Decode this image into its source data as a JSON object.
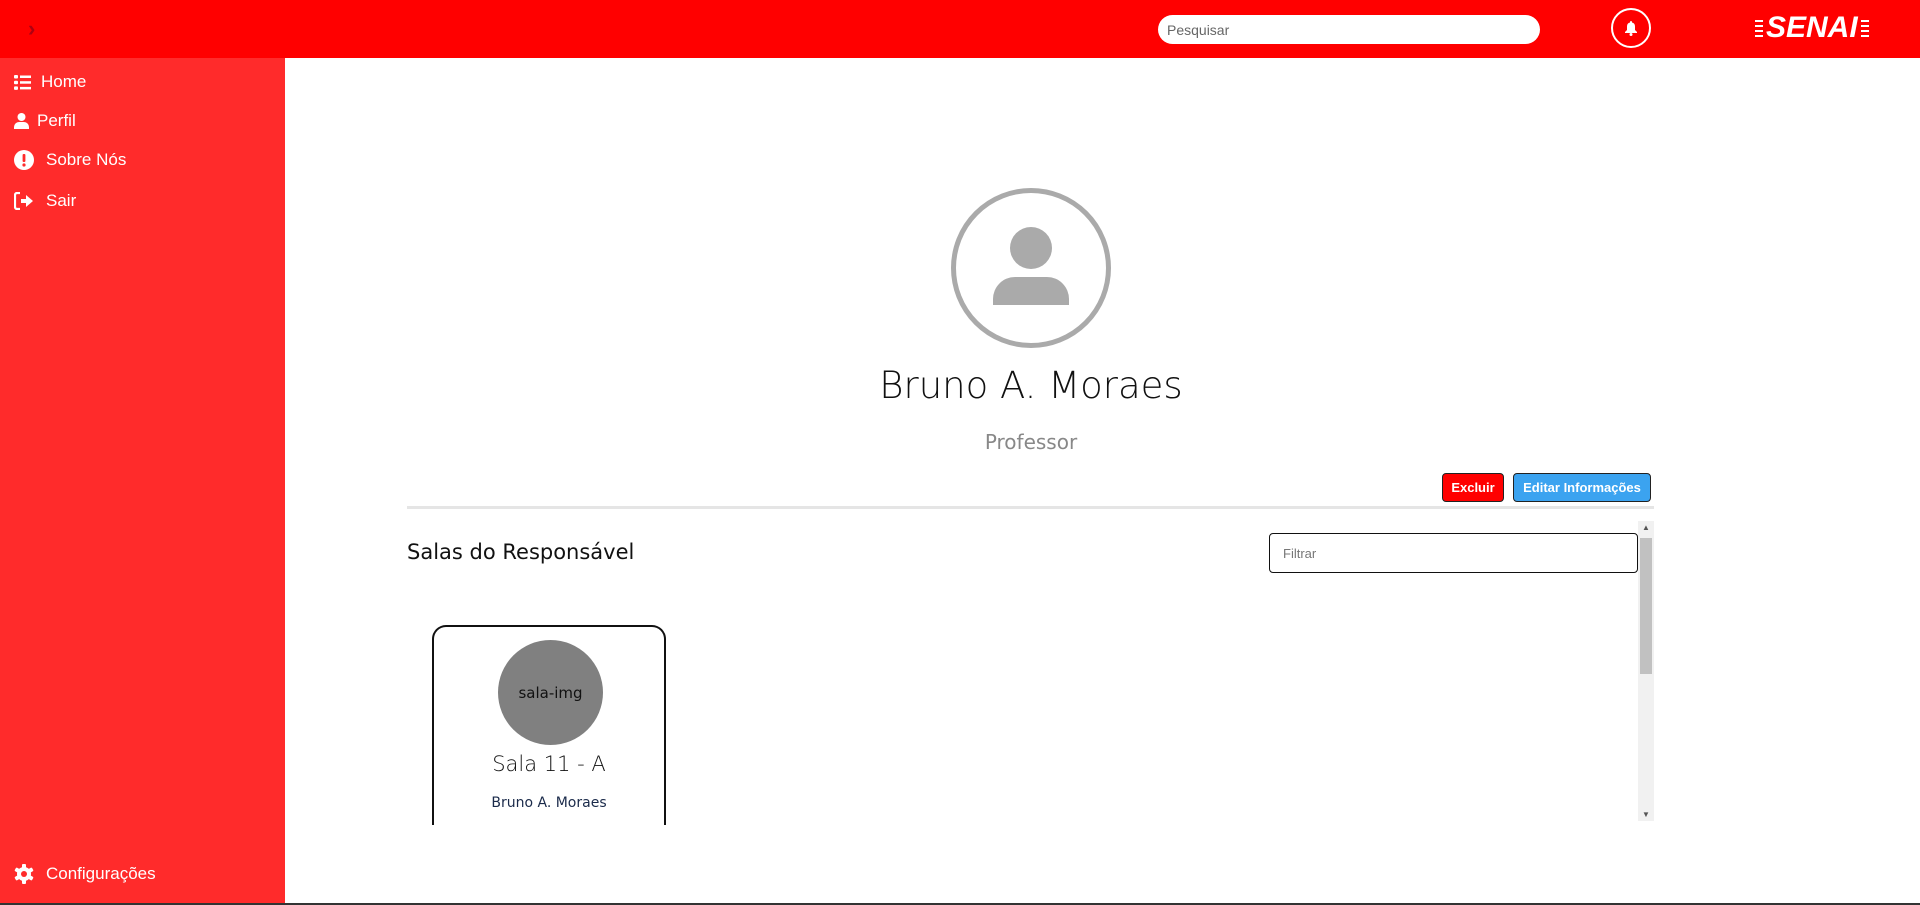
{
  "header": {
    "search_placeholder": "Pesquisar",
    "logo_text": "SENAI"
  },
  "sidebar": {
    "items": [
      {
        "label": "Home"
      },
      {
        "label": "Perfil"
      },
      {
        "label": "Sobre Nós"
      },
      {
        "label": "Sair"
      }
    ],
    "settings_label": "Configurações"
  },
  "profile": {
    "name": "Bruno A. Moraes",
    "role": "Professor",
    "delete_label": "Excluir",
    "edit_label": "Editar Informações"
  },
  "rooms": {
    "title": "Salas do Responsável",
    "filter_placeholder": "Filtrar",
    "cards": [
      {
        "img_alt": "sala-img",
        "title": "Sala 11 - A",
        "owner": "Bruno A. Moraes"
      }
    ]
  },
  "colors": {
    "header": "#ff0000",
    "sidebar": "#ff2b2b",
    "delete": "#ff0000",
    "edit": "#3ba3f0"
  }
}
